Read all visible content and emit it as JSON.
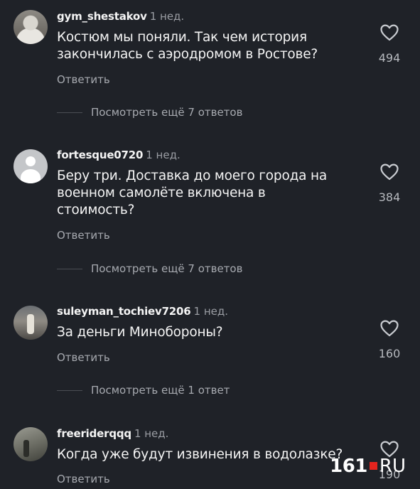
{
  "comments": [
    {
      "username": "gym_shestakov",
      "time": "1 нед.",
      "lines": [
        "Костюм мы поняли. Так чем история",
        "закончилась с аэродромом в Ростове?"
      ],
      "reply_label": "Ответить",
      "likes": "494",
      "more_replies": "Посмотреть ещё 7 ответов",
      "avatar": "user-photo"
    },
    {
      "username": "fortesque0720",
      "time": "1 нед.",
      "lines": [
        "Беру три. Доставка до моего города на",
        "военном самолёте включена в",
        "стоимость?"
      ],
      "reply_label": "Ответить",
      "likes": "384",
      "more_replies": "Посмотреть ещё 7 ответов",
      "avatar": "default-avatar"
    },
    {
      "username": "suleyman_tochiev7206",
      "time": "1 нед.",
      "lines": [
        "За деньги Минобороны?"
      ],
      "reply_label": "Ответить",
      "likes": "160",
      "more_replies": "Посмотреть ещё 1 ответ",
      "avatar": "user-photo"
    },
    {
      "username": "freeriderqqq",
      "time": "1 нед.",
      "lines": [
        "Когда уже будут извинения в водолазке?"
      ],
      "reply_label": "Ответить",
      "likes": "190",
      "avatar": "user-photo"
    }
  ],
  "icons": {
    "like": "heart-outline-icon"
  },
  "watermark": {
    "number": "161",
    "suffix": "RU"
  },
  "colors": {
    "background": "#1f2228",
    "primary_text": "#f4f4f4",
    "secondary_text": "#a7aab0",
    "watermark_accent": "#e4241e"
  }
}
